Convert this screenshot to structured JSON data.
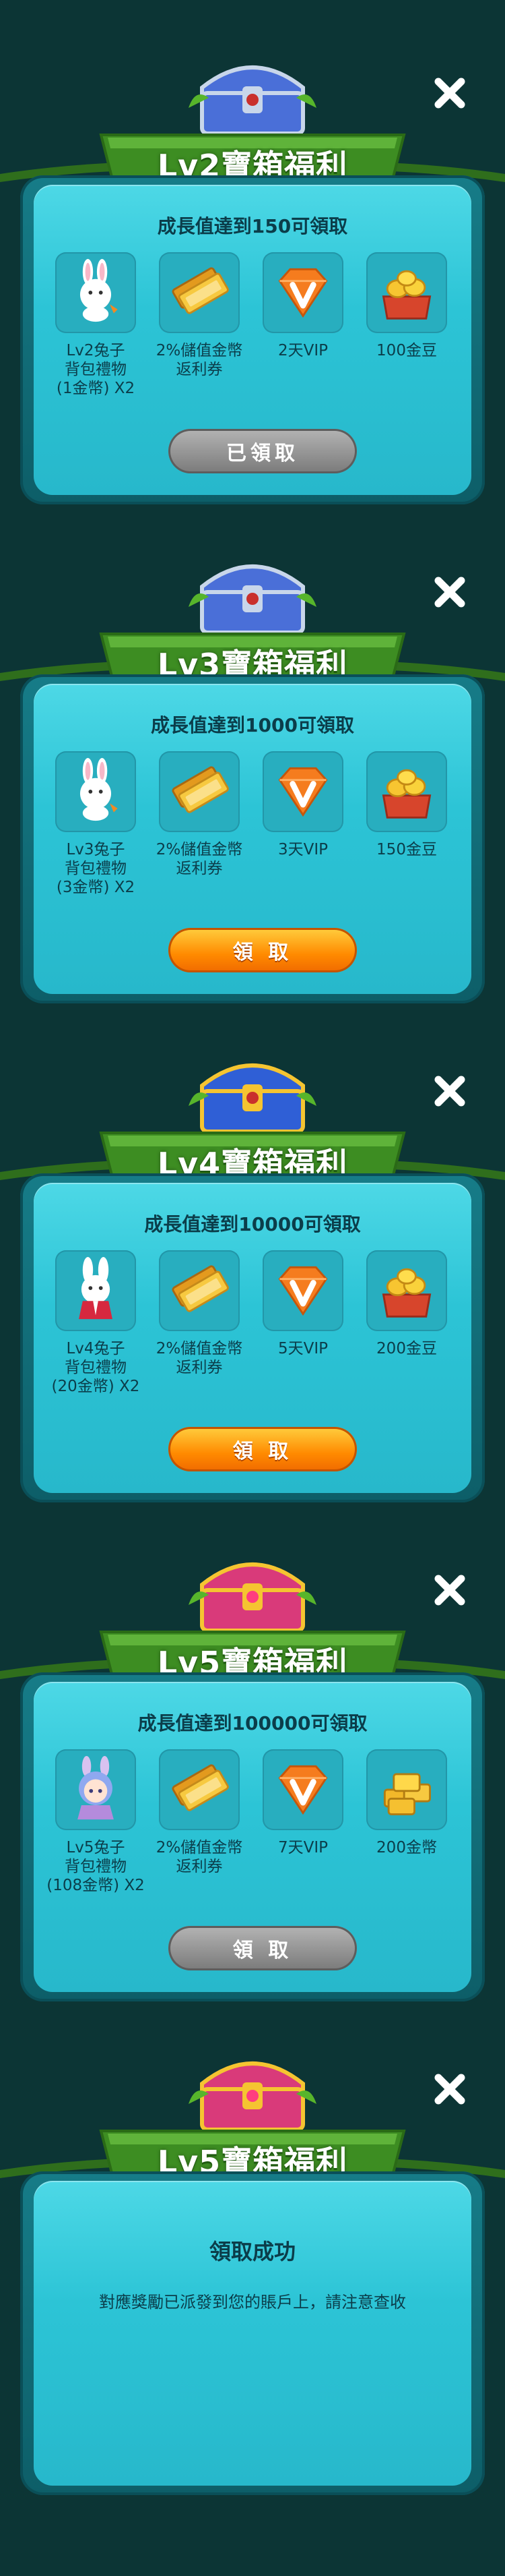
{
  "panels": [
    {
      "title": "Lv2寶箱福利",
      "condition": "成長值達到150可領取",
      "rewards": [
        {
          "icon": "rabbit-plush-icon",
          "label_lines": [
            "Lv2兔子",
            "背包禮物",
            "(1金幣) X2"
          ]
        },
        {
          "icon": "gold-coupon-icon",
          "label_lines": [
            "2%儲值金幣",
            "返利券"
          ]
        },
        {
          "icon": "vip-diamond-icon",
          "label_lines": [
            "2天VIP"
          ]
        },
        {
          "icon": "gold-beans-chest-icon",
          "label_lines": [
            "100金豆"
          ]
        }
      ],
      "button": "已領取",
      "button_state": "claimed"
    },
    {
      "title": "Lv3寶箱福利",
      "condition": "成長值達到1000可領取",
      "rewards": [
        {
          "icon": "rabbit-plush-icon",
          "label_lines": [
            "Lv3兔子",
            "背包禮物",
            "(3金幣) X2"
          ]
        },
        {
          "icon": "gold-coupon-icon",
          "label_lines": [
            "2%儲值金幣",
            "返利券"
          ]
        },
        {
          "icon": "vip-diamond-icon",
          "label_lines": [
            "3天VIP"
          ]
        },
        {
          "icon": "gold-beans-chest-icon",
          "label_lines": [
            "150金豆"
          ]
        }
      ],
      "button": "領 取",
      "button_state": "active"
    },
    {
      "title": "Lv4寶箱福利",
      "condition": "成長值達到10000可領取",
      "rewards": [
        {
          "icon": "rabbit-kimono-icon",
          "label_lines": [
            "Lv4兔子",
            "背包禮物",
            "(20金幣) X2"
          ]
        },
        {
          "icon": "gold-coupon-icon",
          "label_lines": [
            "2%儲值金幣",
            "返利券"
          ]
        },
        {
          "icon": "vip-diamond-icon",
          "label_lines": [
            "5天VIP"
          ]
        },
        {
          "icon": "gold-beans-chest-icon",
          "label_lines": [
            "200金豆"
          ]
        }
      ],
      "button": "領 取",
      "button_state": "active"
    },
    {
      "title": "Lv5寶箱福利",
      "condition": "成長值達到100000可領取",
      "rewards": [
        {
          "icon": "rabbit-girl-icon",
          "label_lines": [
            "Lv5兔子",
            "背包禮物",
            "(108金幣) X2"
          ]
        },
        {
          "icon": "gold-coupon-icon",
          "label_lines": [
            "2%儲值金幣",
            "返利券"
          ]
        },
        {
          "icon": "vip-diamond-icon",
          "label_lines": [
            "7天VIP"
          ]
        },
        {
          "icon": "gold-coins-stack-icon",
          "label_lines": [
            "200金幣"
          ]
        }
      ],
      "button": "領 取",
      "button_state": "disabled"
    }
  ],
  "success_panel": {
    "title": "Lv5寶箱福利",
    "heading": "領取成功",
    "message": "對應獎勵已派發到您的賬戶上，請注意查收"
  },
  "colors": {
    "background": "#0c3535",
    "panel_inner": "#2cc4d6",
    "banner_green": "#3d8d22",
    "button_orange": "#ff8a00",
    "button_gray": "#8a8a8a",
    "text_dark": "#0b3d4a"
  }
}
